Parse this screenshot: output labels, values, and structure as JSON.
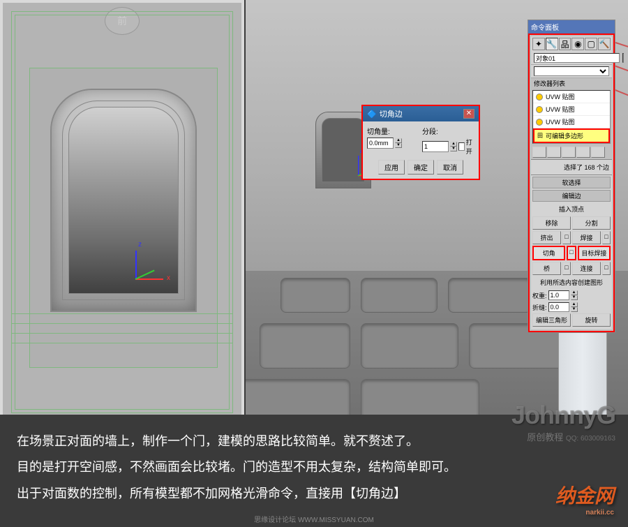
{
  "viewport": {
    "front_label": "前"
  },
  "panel": {
    "title": "命令面板",
    "object_name": "对象01",
    "modifier_list_label": "修改器列表",
    "modifiers": [
      {
        "name": "UVW 贴图"
      },
      {
        "name": "UVW 贴图"
      },
      {
        "name": "UVW 贴图"
      },
      {
        "name": "可编辑多边形",
        "highlighted": true
      }
    ],
    "selection_info": "选择了 168 个边",
    "soft_select": "软选择",
    "edit_edges": "编辑边",
    "insert_vertex": "插入顶点",
    "buttons": {
      "remove": "移除",
      "split": "分割",
      "extrude": "挤出",
      "weld": "焊接",
      "chamfer": "切角",
      "target_weld": "目标焊接",
      "bridge": "桥",
      "connect": "连接"
    },
    "create_shape_label": "利用所选内容创建图形",
    "weight_label": "权重:",
    "weight_value": "1.0",
    "crease_label": "折缝:",
    "crease_value": "0.0",
    "edit_tri": "编辑三角形",
    "turn": "旋转"
  },
  "dialog": {
    "title": "切角边",
    "chamfer_amount_label": "切角量:",
    "chamfer_value": "0.0mm",
    "segments_label": "分段:",
    "segments_value": "1",
    "open_label": "打开",
    "apply": "应用",
    "ok": "确定",
    "cancel": "取消"
  },
  "caption": {
    "line1": "在场景正对面的墙上，制作一个门，建模的思路比较简单。就不赘述了。",
    "line2": "目的是打开空间感，不然画面会比较堵。门的造型不用太复杂，结构简单即可。",
    "line3a": "出于对面数的控制，所有模型都不加网格光滑命令，直接用【切角边】",
    "line3b": ""
  },
  "watermark": {
    "author": "JohnnyG",
    "tagline": "原创教程",
    "qq": "QQ: 603009163",
    "site": "纳金网",
    "site_url": "narkii.cc"
  },
  "footer": "思缘设计论坛  WWW.MISSYUAN.COM"
}
